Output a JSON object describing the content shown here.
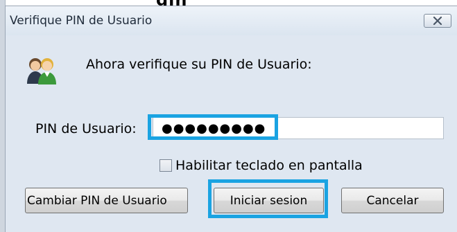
{
  "page_top_fragment": "gin",
  "dialog": {
    "title": "Verifique PIN de Usuario",
    "prompt": "Ahora verifique su PIN de Usuario:",
    "pin": {
      "label": "PIN de Usuario:",
      "masked_value": "●●●●●●●●●"
    },
    "onscreen_keyboard": {
      "label": "Habilitar teclado en pantalla",
      "checked": false
    },
    "buttons": {
      "change_pin": "Cambiar PIN de Usuario",
      "login": "Iniciar sesion",
      "cancel": "Cancelar"
    },
    "icons": {
      "header": "users-icon",
      "close": "close-icon"
    },
    "highlight_color": "#1aa3e2"
  }
}
